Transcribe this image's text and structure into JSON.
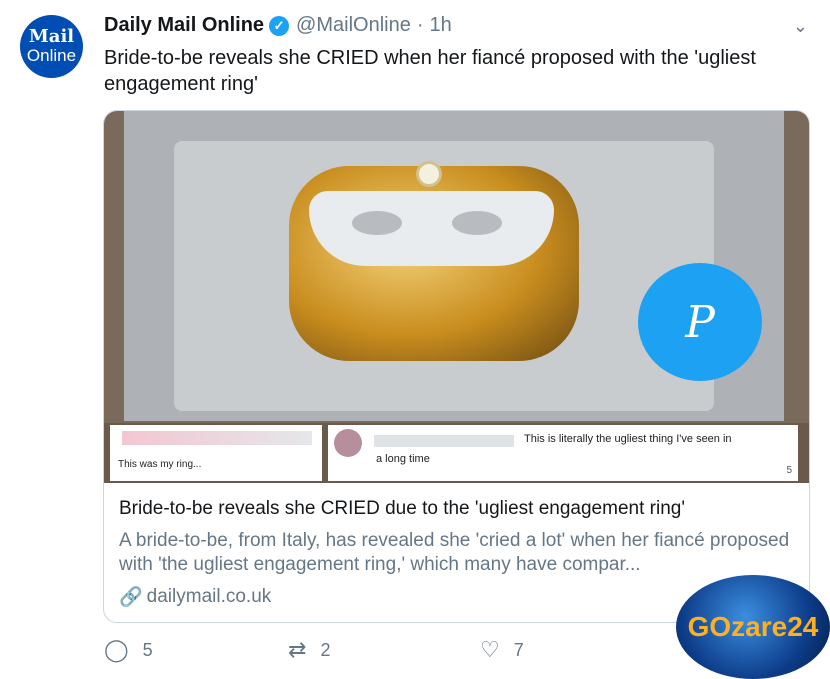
{
  "avatar": {
    "line1": "Mail",
    "line2": "Online"
  },
  "tweet": {
    "author_name": "Daily Mail Online",
    "verified_icon": "verified-check-icon",
    "handle": "@MailOnline",
    "separator": "·",
    "time": "1h",
    "menu_icon": "chevron-down-icon",
    "text": "Bride-to-be reveals she CRIED when her fiancé proposed with the 'ugliest engagement ring'"
  },
  "image": {
    "badge_letter": "P",
    "comment1": "This was my ring...",
    "comment2_line1": "This is literally the ugliest thing I've seen in",
    "comment2_line2": "a long time",
    "comment2_count": "5"
  },
  "card": {
    "title": "Bride-to-be reveals she CRIED due to the 'ugliest engagement ring'",
    "description": "A bride-to-be, from Italy, has revealed she 'cried a lot' when her fiancé proposed with 'the ugliest engagement ring,' which many have compar...",
    "domain": "dailymail.co.uk"
  },
  "actions": {
    "replies": "5",
    "retweets": "2",
    "likes": "7"
  },
  "watermark": {
    "text": "GOzare24"
  },
  "colors": {
    "accent": "#1da1f2",
    "brand": "#004db3",
    "muted": "#657786"
  }
}
